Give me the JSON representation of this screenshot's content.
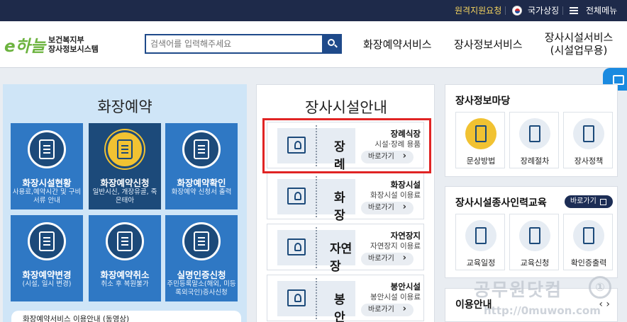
{
  "topbar": {
    "remote_support": "원격지원요청",
    "national_symbol": "국가상징",
    "all_menu": "전체메뉴"
  },
  "header": {
    "logo_mark": "e하늘",
    "org_line1": "보건복지부",
    "org_line2": "장사정보시스템",
    "search_placeholder": "검색어를 입력해주세요",
    "nav": [
      {
        "line1": "화장예약서비스",
        "line2": ""
      },
      {
        "line1": "장사정보서비스",
        "line2": ""
      },
      {
        "line1": "장사시설서비스",
        "line2": "(시설업무용)"
      }
    ]
  },
  "left_panel": {
    "title": "화장예약",
    "tiles": [
      {
        "title": "화장시설현황",
        "desc": "사용료,예약시간 및 구비서류 안내",
        "icon": "calendar-icon",
        "active": false
      },
      {
        "title": "화장예약신청",
        "desc": "일반시신, 개장유골, 죽은태아",
        "icon": "edit-icon",
        "active": true
      },
      {
        "title": "화장예약확인",
        "desc": "화장예약 신청서 출력",
        "icon": "document-check-icon",
        "active": false
      },
      {
        "title": "화장예약변경",
        "desc": "(시설, 일시 변경)",
        "icon": "document-edit-icon",
        "active": false
      },
      {
        "title": "화장예약취소",
        "desc": "취소 후 복원불가",
        "icon": "document-cancel-icon",
        "active": false
      },
      {
        "title": "실명인증신청",
        "desc": "주민등록말소(해외, 미등록외국인)증사신청",
        "icon": "id-card-icon",
        "active": false
      }
    ],
    "notice": "화장예약서비스 이용안내 (동영상)"
  },
  "middle_panel": {
    "title": "장사시설안내",
    "cards": [
      {
        "picture_label": "장례",
        "title": "장례식장",
        "desc": "시설·장례 용품",
        "link": "바로가기",
        "icon": "person-frame-icon"
      },
      {
        "picture_label": "화장",
        "title": "화장시설",
        "desc": "화장시설 이용료",
        "link": "바로가기",
        "icon": "building-icon"
      },
      {
        "picture_label": "자연장",
        "title": "자연장지",
        "desc": "자연장지 이용료",
        "link": "바로가기",
        "icon": "sprout-icon"
      },
      {
        "picture_label": "봉안",
        "title": "봉안시설",
        "desc": "봉안시설 이용료",
        "link": "바로가기",
        "icon": "house-plant-icon"
      }
    ]
  },
  "right_panel_info": {
    "title": "장사정보마당",
    "items": [
      {
        "label": "문상방법",
        "icon": "lantern-icon"
      },
      {
        "label": "장례절차",
        "icon": "clipboard-icon"
      },
      {
        "label": "장사정책",
        "icon": "books-icon"
      }
    ]
  },
  "right_panel_education": {
    "title": "장사시설종사인력교육",
    "go_label": "바로가기",
    "items": [
      {
        "label": "교육일정",
        "icon": "calendar-28-icon"
      },
      {
        "label": "교육신청",
        "icon": "phone-check-icon"
      },
      {
        "label": "확인증출력",
        "icon": "printer-icon"
      }
    ]
  },
  "right_panel_usage": {
    "title": "이용안내"
  },
  "watermark": {
    "line1": "공무원닷컴",
    "line2": "http://0muwon.com"
  },
  "colors": {
    "navy": "#1e2a4a",
    "primary_blue": "#2f78c4",
    "dark_tile": "#1c4a7a",
    "light_panel": "#cfe5f7",
    "highlight_red": "#e02424",
    "accent_yellow": "#f1c232"
  }
}
